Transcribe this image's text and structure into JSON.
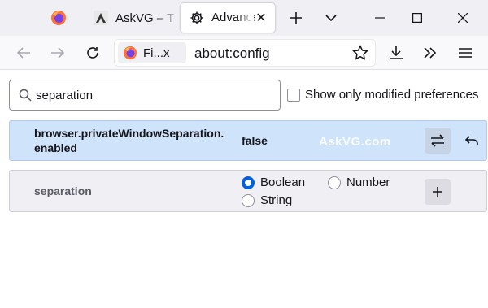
{
  "tabs": [
    {
      "title": "",
      "icon": "firefox-icon",
      "pinned": true
    },
    {
      "title": "AskVG – T",
      "icon": "askvg-icon"
    },
    {
      "title": "Advanced",
      "icon": "gear-icon",
      "active": true
    }
  ],
  "urlbar": {
    "identity_label": "Fi...x",
    "url": "about:config"
  },
  "search": {
    "value": "separation"
  },
  "modified_only_label": "Show only modified preferences",
  "preferences": [
    {
      "name_line1": "browser.privateWindowSeparation.",
      "name_line2": "enabled",
      "value": "false"
    }
  ],
  "new_pref": {
    "name": "separation",
    "types": [
      "Boolean",
      "Number",
      "String"
    ],
    "selected_type": "Boolean"
  },
  "watermark": "AskVG.com",
  "colors": {
    "accent": "#0060df",
    "row_highlight": "#cfe3fb",
    "tabstrip": "#f0f0f4"
  }
}
